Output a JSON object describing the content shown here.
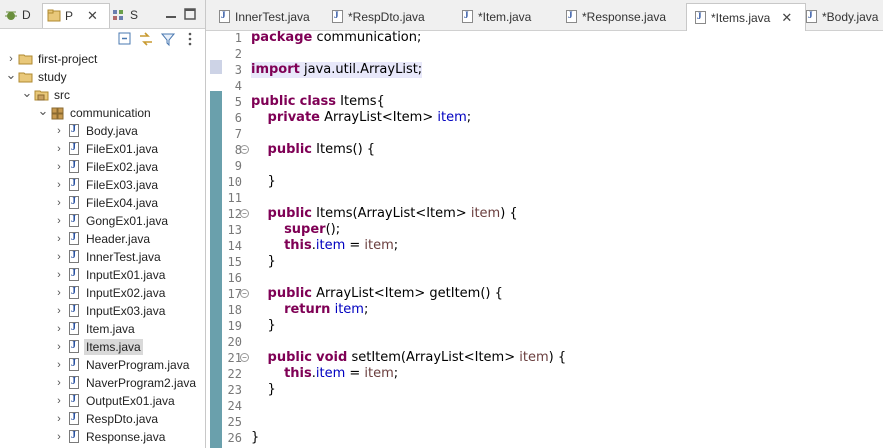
{
  "left_panel": {
    "tabs": [
      {
        "label": "D",
        "icon": "debug-icon"
      },
      {
        "label": "P",
        "icon": "package-explorer-icon"
      },
      {
        "label": "S",
        "icon": "servers-icon"
      }
    ],
    "tree": [
      {
        "label": "first-project",
        "kind": "project",
        "depth": 0,
        "expanded": false
      },
      {
        "label": "study",
        "kind": "project",
        "depth": 0,
        "expanded": true
      },
      {
        "label": "src",
        "kind": "source-folder",
        "depth": 1,
        "expanded": true
      },
      {
        "label": "communication",
        "kind": "package",
        "depth": 2,
        "expanded": true
      },
      {
        "label": "Body.java",
        "kind": "java-file",
        "depth": 3
      },
      {
        "label": "FileEx01.java",
        "kind": "java-file",
        "depth": 3
      },
      {
        "label": "FileEx02.java",
        "kind": "java-file",
        "depth": 3
      },
      {
        "label": "FileEx03.java",
        "kind": "java-file",
        "depth": 3
      },
      {
        "label": "FileEx04.java",
        "kind": "java-file",
        "depth": 3
      },
      {
        "label": "GongEx01.java",
        "kind": "java-file",
        "depth": 3
      },
      {
        "label": "Header.java",
        "kind": "java-file",
        "depth": 3
      },
      {
        "label": "InnerTest.java",
        "kind": "java-file",
        "depth": 3
      },
      {
        "label": "InputEx01.java",
        "kind": "java-file",
        "depth": 3
      },
      {
        "label": "InputEx02.java",
        "kind": "java-file",
        "depth": 3
      },
      {
        "label": "InputEx03.java",
        "kind": "java-file",
        "depth": 3
      },
      {
        "label": "Item.java",
        "kind": "java-file",
        "depth": 3
      },
      {
        "label": "Items.java",
        "kind": "java-file",
        "depth": 3,
        "selected": true
      },
      {
        "label": "NaverProgram.java",
        "kind": "java-file",
        "depth": 3
      },
      {
        "label": "NaverProgram2.java",
        "kind": "java-file",
        "depth": 3
      },
      {
        "label": "OutputEx01.java",
        "kind": "java-file",
        "depth": 3
      },
      {
        "label": "RespDto.java",
        "kind": "java-file",
        "depth": 3
      },
      {
        "label": "Response.java",
        "kind": "java-file",
        "depth": 3
      }
    ]
  },
  "editor": {
    "tabs": [
      {
        "label": "InnerTest.java"
      },
      {
        "label": "*RespDto.java"
      },
      {
        "label": "*Item.java"
      },
      {
        "label": "*Response.java"
      },
      {
        "label": "*Items.java",
        "active": true
      },
      {
        "label": "*Body.java"
      }
    ],
    "lines": [
      "package communication;",
      "",
      "import java.util.ArrayList;",
      "",
      "public class Items{",
      "    private ArrayList<Item> item;",
      "",
      "    public Items() {",
      "",
      "    }",
      "",
      "    public Items(ArrayList<Item> item) {",
      "        super();",
      "        this.item = item;",
      "    }",
      "",
      "    public ArrayList<Item> getItem() {",
      "        return item;",
      "    }",
      "",
      "    public void setItem(ArrayList<Item> item) {",
      "        this.item = item;",
      "    }",
      "",
      "",
      "}"
    ]
  },
  "colors": {
    "keyword": "#7f0055",
    "field": "#0000c0",
    "parameter": "#6a3e3e",
    "gutter_marker": "#6aa0ac"
  }
}
